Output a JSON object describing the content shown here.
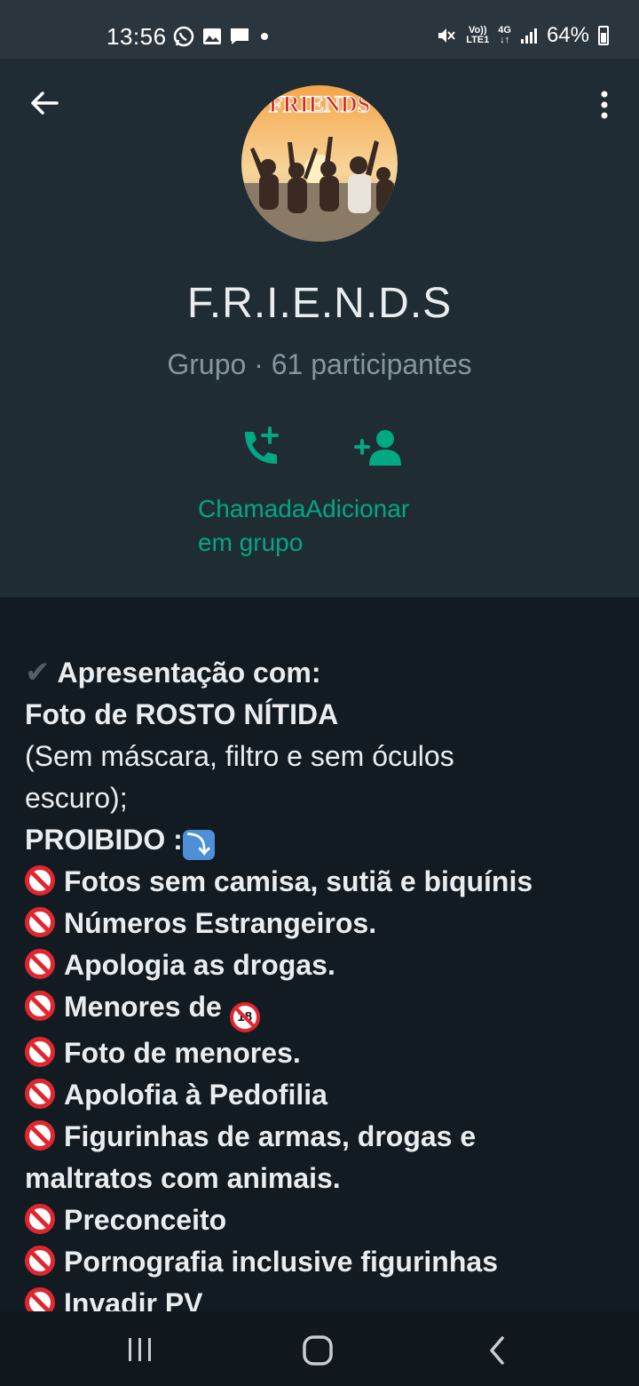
{
  "status_bar": {
    "time": "13:56",
    "battery": "64%",
    "volte_top": "Vo))",
    "volte_bottom": "LTE1",
    "network": "4G"
  },
  "header": {
    "avatar_text": "FRIENDS",
    "group_name": "F.R.I.E.N.D.S",
    "subtitle": "Grupo · 61 participantes",
    "action_labels_line1": "ChamadaAdicionar",
    "action_labels_line2": "em grupo"
  },
  "description": {
    "l1": "Apresentação com:",
    "l2": " Foto de ROSTO NÍTIDA",
    "l3": "(Sem máscara, filtro e sem óculos",
    "l4": "escuro);",
    "l5": "PROIBIDO :",
    "l6": "Fotos sem camisa, sutiã e biquínis",
    "l7": "Números Estrangeiros.",
    "l8": "Apologia as drogas.",
    "l9": "Menores de",
    "l10": "Foto de menores.",
    "l11": "Apolofia à Pedofilia",
    "l12": "Figurinhas de armas, drogas e",
    "l13": "maltratos com animais.",
    "l14": "Preconceito",
    "l15": "Pornografia inclusive figurinhas",
    "l16": "Invadir PV"
  },
  "colors": {
    "accent": "#00a884",
    "header_bg": "#1f2c34",
    "body_bg": "#121b22",
    "ban_red": "#e0262f"
  }
}
